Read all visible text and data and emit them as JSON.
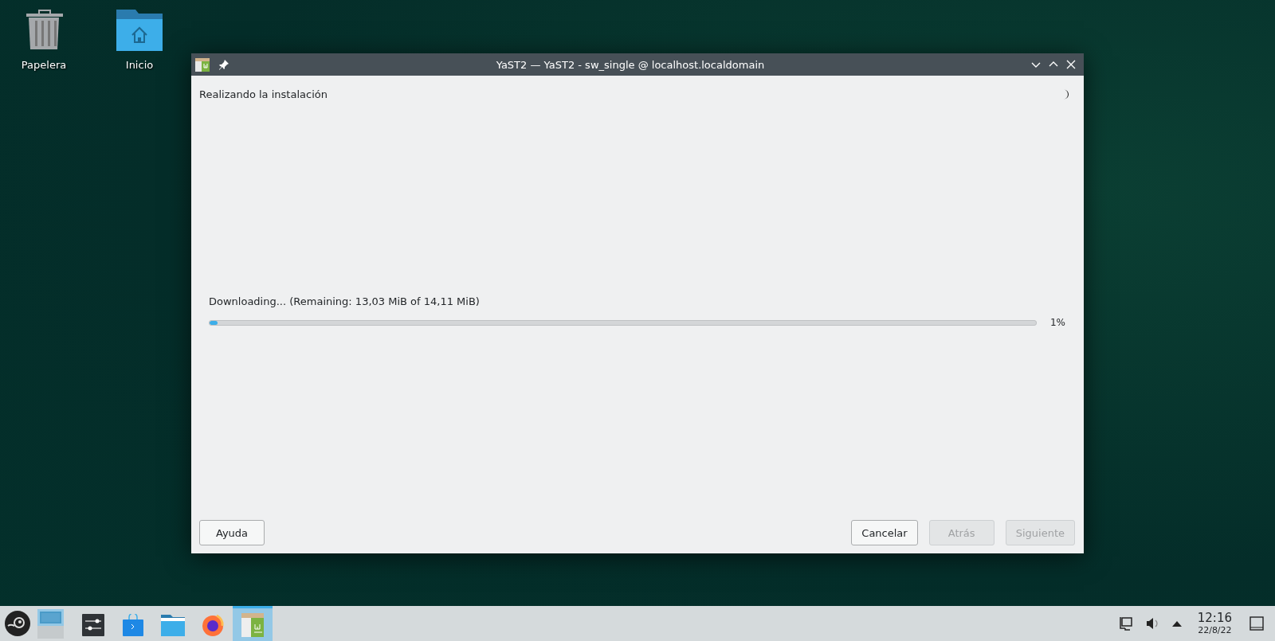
{
  "desktop_icons": [
    {
      "kind": "trash",
      "label": "Papelera"
    },
    {
      "kind": "home",
      "label": "Inicio"
    }
  ],
  "window": {
    "title": "YaST2 — YaST2 - sw_single @ localhost.localdomain",
    "heading": "Realizando la instalación",
    "progress": {
      "label": "Downloading... (Remaining: 13,03 MiB of 14,11 MiB)",
      "level": 0.01,
      "reading": "1%"
    },
    "help_button": {
      "label": "Ayuda"
    },
    "buttons": [
      {
        "label": "Cancelar",
        "disabled": false
      },
      {
        "label": "Atrás",
        "disabled": true
      },
      {
        "label": "Siguiente",
        "disabled": true
      }
    ]
  },
  "taskbar": {
    "tasks": [
      {
        "kind": "settings",
        "selected": false
      },
      {
        "kind": "store",
        "selected": false
      },
      {
        "kind": "folder",
        "selected": false
      },
      {
        "kind": "browser",
        "selected": false
      },
      {
        "kind": "package",
        "selected": true
      }
    ],
    "clock": {
      "time": "12:16",
      "date": "22/8/22"
    }
  }
}
